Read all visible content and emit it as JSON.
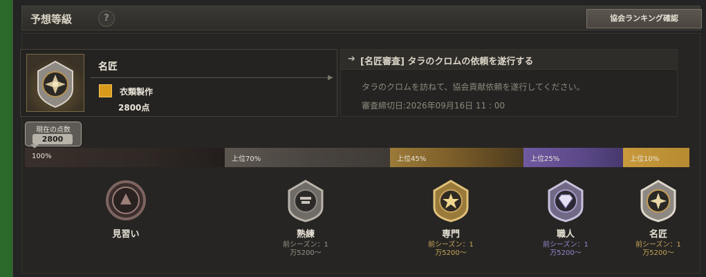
{
  "header": {
    "title": "予想等級",
    "help_label": "?",
    "ranking_button": "協会ランキング確認"
  },
  "card": {
    "rank_name": "名匠",
    "job_name": "衣類製作",
    "points": "2800点"
  },
  "quest": {
    "title": "[名匠審査] タラのクロムの依頼を遂行する",
    "description": "タラのクロムを訪ねて、協会貢献依頼を遂行してください。",
    "deadline": "審査締切日:2026年09月16日 11 : 00"
  },
  "current_score": {
    "label": "現在の点数",
    "value": "2800"
  },
  "progress_segments": [
    {
      "label": "100%"
    },
    {
      "label": "上位70%"
    },
    {
      "label": "上位45%"
    },
    {
      "label": "上位25%"
    },
    {
      "label": "上位10%"
    }
  ],
  "tiers": [
    {
      "name": "見習い",
      "req1": "",
      "req2": ""
    },
    {
      "name": "熟練",
      "req1": "前シーズン：1",
      "req2": "万5200～"
    },
    {
      "name": "専門",
      "req1": "前シーズン：1",
      "req2": "万5200～"
    },
    {
      "name": "職人",
      "req1": "前シーズン：1",
      "req2": "万5200～"
    },
    {
      "name": "名匠",
      "req1": "前シーズン：1",
      "req2": "万5200～"
    }
  ],
  "colors": {
    "tier_req_gray": "#9a948a",
    "tier_req_gold": "#c9a55a",
    "tier_req_purple": "#9a86cf",
    "accent_gold": "#c89a3c"
  }
}
